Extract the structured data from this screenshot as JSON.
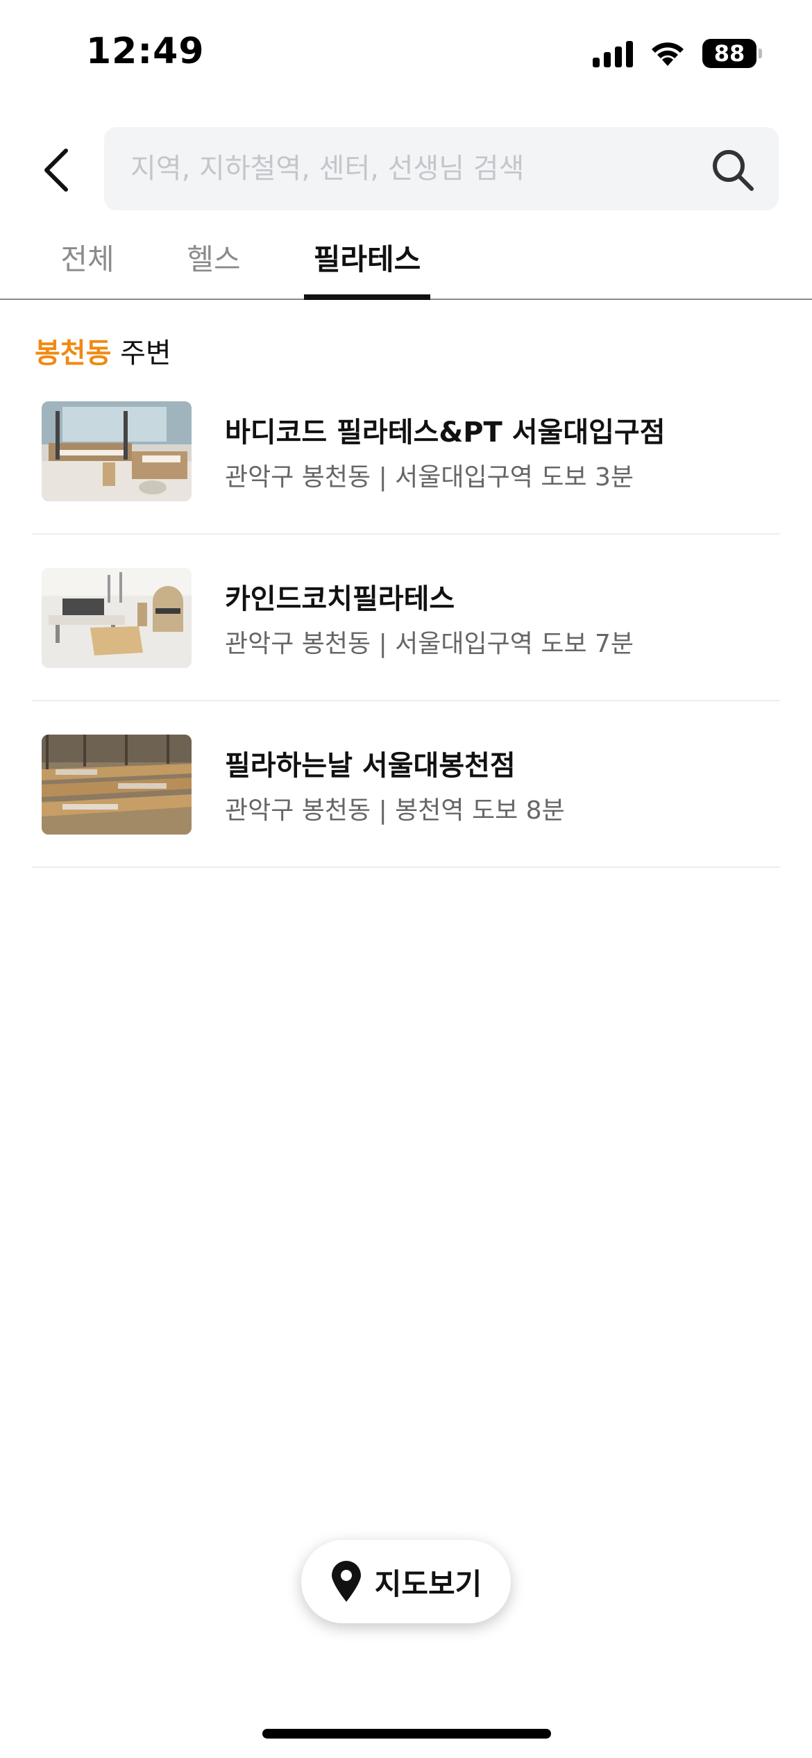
{
  "status_bar": {
    "time": "12:49",
    "battery": "88"
  },
  "search": {
    "placeholder": "지역, 지하철역, 센터, 선생님 검색",
    "value": ""
  },
  "tabs": [
    {
      "label": "전체",
      "active": false
    },
    {
      "label": "헬스",
      "active": false
    },
    {
      "label": "필라테스",
      "active": true
    }
  ],
  "section": {
    "region": "봉천동",
    "suffix": " 주변"
  },
  "gyms": [
    {
      "name": "바디코드 필라테스&PT 서울대입구점",
      "meta": "관악구 봉천동 | 서울대입구역 도보 3분"
    },
    {
      "name": "카인드코치필라테스",
      "meta": "관악구 봉천동 | 서울대입구역 도보 7분"
    },
    {
      "name": "필라하는날 서울대봉천점",
      "meta": "관악구 봉천동 | 봉천역 도보 8분"
    }
  ],
  "map_button": {
    "label": "지도보기"
  },
  "colors": {
    "accent": "#f08a12",
    "text": "#111111",
    "subtext": "#666666",
    "search_bg": "#f3f4f6"
  },
  "icons": [
    "signal-icon",
    "wifi-icon",
    "battery-icon",
    "back-arrow-icon",
    "search-icon",
    "map-pin-icon"
  ]
}
